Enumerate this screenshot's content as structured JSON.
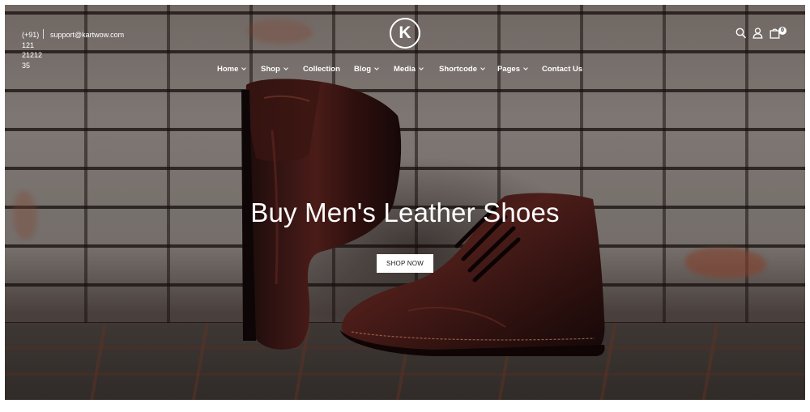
{
  "header": {
    "phone": "(+91) 121 21212 35",
    "email": "support@kartwow.com",
    "logo_letter": "K",
    "cart_count": "0"
  },
  "nav": {
    "items": [
      {
        "label": "Home",
        "has_dropdown": true
      },
      {
        "label": "Shop",
        "has_dropdown": true
      },
      {
        "label": "Collection",
        "has_dropdown": false
      },
      {
        "label": "Blog",
        "has_dropdown": true
      },
      {
        "label": "Media",
        "has_dropdown": true
      },
      {
        "label": "Shortcode",
        "has_dropdown": true
      },
      {
        "label": "Pages",
        "has_dropdown": true
      },
      {
        "label": "Contact Us",
        "has_dropdown": false
      }
    ]
  },
  "hero": {
    "headline": "Buy Men's Leather Shoes",
    "cta_label": "SHOP NOW"
  },
  "icons": {
    "search": "search-icon",
    "account": "user-icon",
    "cart": "shopping-bag-icon",
    "dropdown": "chevron-down-icon"
  },
  "colors": {
    "text": "#ffffff",
    "button_bg": "#ffffff",
    "button_text": "#1a1a1a"
  }
}
